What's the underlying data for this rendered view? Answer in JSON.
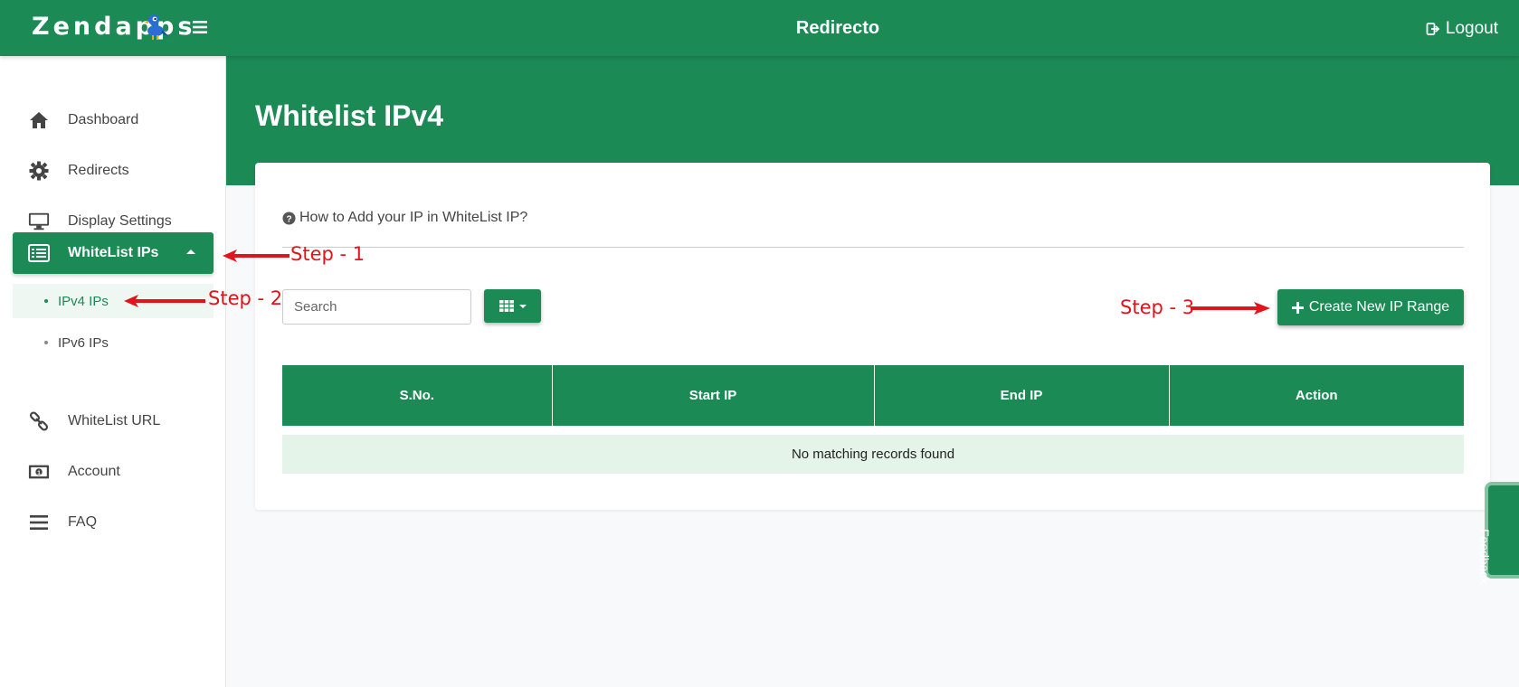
{
  "header": {
    "brand": "Zendapps",
    "app_title": "Redirecto",
    "logout_label": "Logout"
  },
  "sidebar": {
    "items": [
      {
        "label": "Dashboard",
        "icon": "home-icon"
      },
      {
        "label": "Redirects",
        "icon": "gear-icon"
      },
      {
        "label": "Display Settings",
        "icon": "monitor-icon"
      },
      {
        "label": "WhiteList IPs",
        "icon": "list-icon",
        "expanded": true
      },
      {
        "label": "WhiteList URL",
        "icon": "link-icon"
      },
      {
        "label": "Account",
        "icon": "money-icon"
      },
      {
        "label": "FAQ",
        "icon": "bars-icon"
      }
    ],
    "sub_items": [
      {
        "label": "IPv4 IPs",
        "active": true
      },
      {
        "label": "IPv6 IPs",
        "active": false
      }
    ]
  },
  "page": {
    "title": "Whitelist IPv4",
    "help_text": "How to Add your IP in WhiteList IP?",
    "search_placeholder": "Search",
    "create_button": "Create New IP Range"
  },
  "table": {
    "columns": [
      "S.No.",
      "Start IP",
      "End IP",
      "Action"
    ],
    "empty_message": "No matching records found"
  },
  "annotations": {
    "step1": "Step - 1",
    "step2": "Step - 2",
    "step3": "Step - 3"
  },
  "feedback_tab": "Feedback",
  "colors": {
    "brand_green": "#1c8a55",
    "empty_row_bg": "#e5f4e8",
    "annotation_red": "#e0141a"
  }
}
